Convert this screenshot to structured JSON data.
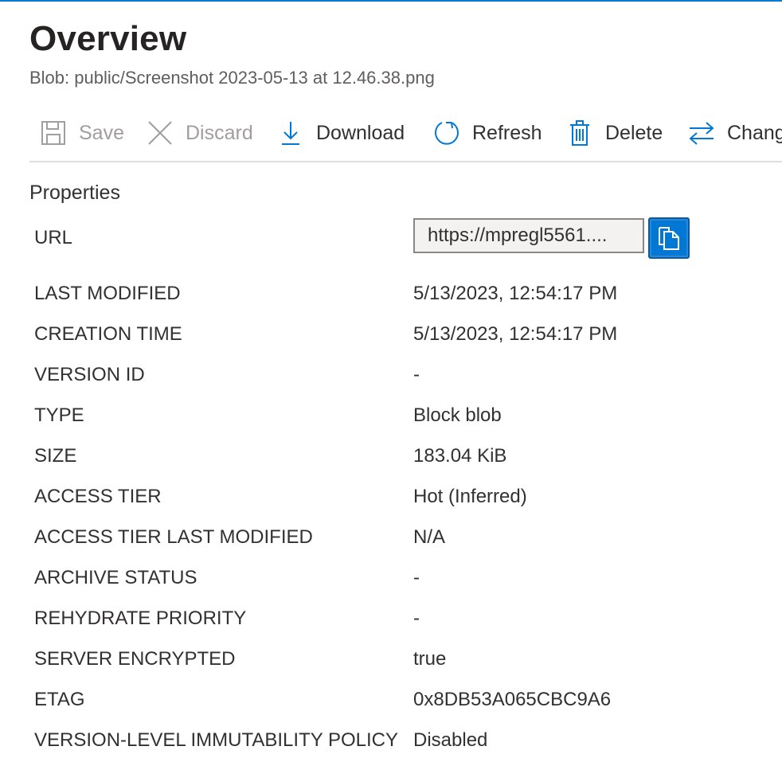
{
  "header": {
    "title": "Overview",
    "subtitle": "Blob: public/Screenshot 2023-05-13 at 12.46.38.png"
  },
  "toolbar": {
    "save": "Save",
    "discard": "Discard",
    "download": "Download",
    "refresh": "Refresh",
    "delete": "Delete",
    "change": "Change tier"
  },
  "properties": {
    "title": "Properties",
    "url_label": "URL",
    "url_value": "https://mpregl5561....",
    "rows": [
      {
        "key": "LAST MODIFIED",
        "value": "5/13/2023, 12:54:17 PM"
      },
      {
        "key": "CREATION TIME",
        "value": "5/13/2023, 12:54:17 PM"
      },
      {
        "key": "VERSION ID",
        "value": "-"
      },
      {
        "key": "TYPE",
        "value": "Block blob"
      },
      {
        "key": "SIZE",
        "value": "183.04 KiB"
      },
      {
        "key": "ACCESS TIER",
        "value": "Hot (Inferred)"
      },
      {
        "key": "ACCESS TIER LAST MODIFIED",
        "value": "N/A"
      },
      {
        "key": "ARCHIVE STATUS",
        "value": "-"
      },
      {
        "key": "REHYDRATE PRIORITY",
        "value": "-"
      },
      {
        "key": "SERVER ENCRYPTED",
        "value": "true"
      },
      {
        "key": "ETAG",
        "value": "0x8DB53A065CBC9A6"
      },
      {
        "key": "VERSION-LEVEL IMMUTABILITY POLICY",
        "value": "Disabled"
      }
    ]
  },
  "colors": {
    "accent": "#0078d4",
    "disabled": "#a19f9d",
    "text": "#323130"
  }
}
